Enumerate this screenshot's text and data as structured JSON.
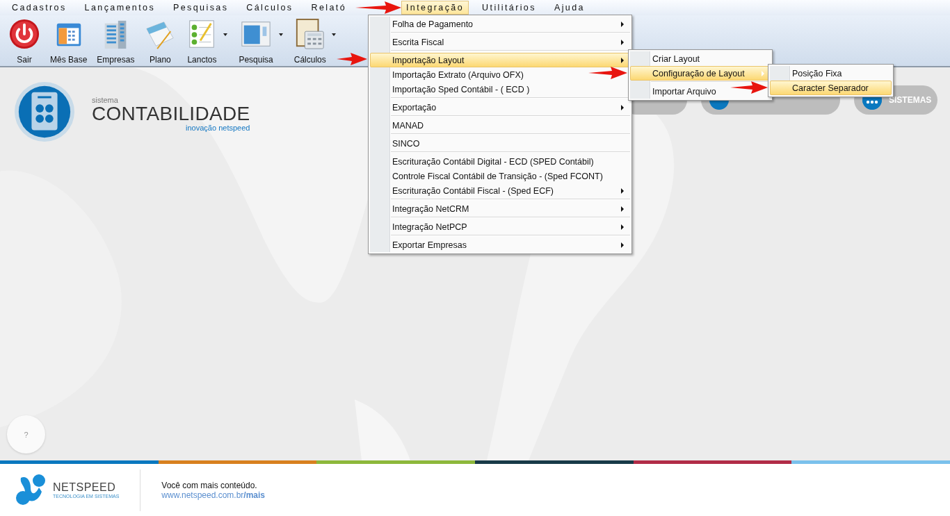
{
  "menu_bar": [
    {
      "label": "Cadastros",
      "selected": false
    },
    {
      "label": "Lançamentos",
      "selected": false
    },
    {
      "label": "Pesquisas",
      "selected": false
    },
    {
      "label": "Cálculos",
      "selected": false
    },
    {
      "label": "Relató",
      "selected": false
    },
    {
      "label": "Integração",
      "selected": true
    },
    {
      "label": "Utilitários",
      "selected": false
    },
    {
      "label": "Ajuda",
      "selected": false
    }
  ],
  "toolbar": [
    {
      "label": "Sair",
      "kind": "power",
      "dropdown": false
    },
    {
      "label": "Mês Base",
      "kind": "calendar",
      "dropdown": false
    },
    {
      "label": "Empresas",
      "kind": "building",
      "dropdown": false
    },
    {
      "label": "Plano",
      "kind": "notepad",
      "dropdown": false
    },
    {
      "label": "Lanctos",
      "kind": "checklist",
      "dropdown": true
    },
    {
      "label": "Pesquisa",
      "kind": "window",
      "dropdown": true
    },
    {
      "label": "Cálculos",
      "kind": "calculator",
      "dropdown": true
    }
  ],
  "integracao_menu": [
    {
      "label": "Folha de Pagamento",
      "submenu": true,
      "separator": true,
      "selected": false
    },
    {
      "label": "Escrita Fiscal",
      "submenu": true,
      "separator": true,
      "selected": false
    },
    {
      "label": "Importação Layout",
      "submenu": true,
      "separator": false,
      "selected": true
    },
    {
      "label": "Importação Extrato (Arquivo OFX)",
      "submenu": false,
      "separator": false,
      "selected": false
    },
    {
      "label": "Importação Sped Contábil - ( ECD )",
      "submenu": false,
      "separator": true,
      "selected": false
    },
    {
      "label": "Exportação",
      "submenu": true,
      "separator": true,
      "selected": false
    },
    {
      "label": "MANAD",
      "submenu": false,
      "separator": true,
      "selected": false
    },
    {
      "label": "SINCO",
      "submenu": false,
      "separator": true,
      "selected": false
    },
    {
      "label": "Escrituração Contábil Digital - ECD (SPED Contábil)",
      "submenu": false,
      "separator": false,
      "selected": false
    },
    {
      "label": "Controle Fiscal Contábil de Transição - (Sped FCONT)",
      "submenu": false,
      "separator": false,
      "selected": false
    },
    {
      "label": "Escrituração Contábil Fiscal - (Sped ECF)",
      "submenu": true,
      "separator": true,
      "selected": false
    },
    {
      "label": "Integração NetCRM",
      "submenu": true,
      "separator": true,
      "selected": false
    },
    {
      "label": "Integração NetPCP",
      "submenu": true,
      "separator": true,
      "selected": false
    },
    {
      "label": "Exportar Empresas",
      "submenu": true,
      "separator": false,
      "selected": false
    }
  ],
  "layout_submenu": [
    {
      "label": "Criar Layout",
      "submenu": false,
      "separator": false,
      "selected": false
    },
    {
      "label": "Configuração de Layout",
      "submenu": true,
      "separator": true,
      "selected": true
    },
    {
      "label": "Importar Arquivo",
      "submenu": false,
      "separator": false,
      "selected": false
    }
  ],
  "configuracao_submenu": [
    {
      "label": "Posição Fixa",
      "submenu": false,
      "separator": false,
      "selected": false
    },
    {
      "label": "Caracter Separador",
      "submenu": false,
      "separator": false,
      "selected": true
    }
  ],
  "brand": {
    "prefix": "sistema",
    "name": "CONTABILIDADE",
    "tagline": "inovação netspeed"
  },
  "shortcut_pills": [
    {
      "label": "SISTEMAS"
    }
  ],
  "help_button": {
    "label": "?"
  },
  "footer": {
    "stripe": [
      {
        "color": "#0a78bf"
      },
      {
        "color": "#d8801f"
      },
      {
        "color": "#8db83b"
      },
      {
        "color": "#183a48"
      },
      {
        "color": "#b12c47"
      },
      {
        "color": "#7bc1ec"
      }
    ],
    "logo_name": "NETSPEED",
    "logo_tagline": "TECNOLOGIA EM SISTEMAS",
    "message": "Você com mais conteúdo.",
    "link": "www.netspeed.com.br**/mais**"
  }
}
